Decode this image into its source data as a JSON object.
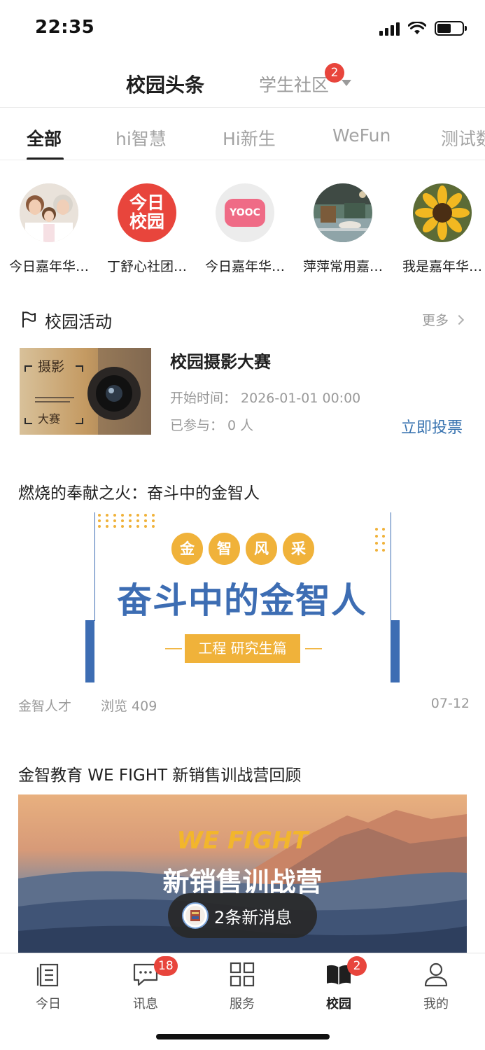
{
  "status_bar": {
    "time": "22:35"
  },
  "header": {
    "active_tab": "校园头条",
    "other_tab": "学生社区",
    "other_tab_badge": "2"
  },
  "category_tabs": [
    "全部",
    "hi智慧",
    "Hi新生",
    "WeFun",
    "测试数"
  ],
  "avatars": [
    {
      "label": "今日嘉年华…",
      "icon": "family-photo"
    },
    {
      "label": "丁舒心社团…",
      "icon": "jinri-xiaoyuan-logo",
      "logo_text_1": "今日",
      "logo_text_2": "校园"
    },
    {
      "label": "今日嘉年华…",
      "icon": "yooc-logo",
      "logo_text": "YOOC"
    },
    {
      "label": "萍萍常用嘉…",
      "icon": "interior-photo"
    },
    {
      "label": "我是嘉年华…",
      "icon": "sunflower-photo"
    }
  ],
  "activity_section": {
    "title": "校园活动",
    "more": "更多",
    "card": {
      "title": "校园摄影大赛",
      "start_time": "开始时间：  2026-01-01 00:00",
      "participants": "已参与：  0 人",
      "action": "立即投票",
      "thumb_text_1": "摄影",
      "thumb_text_2": "大赛"
    }
  },
  "article1": {
    "title": "燃烧的奉献之火：奋斗中的金智人",
    "banner": {
      "circles": [
        "金",
        "智",
        "风",
        "采"
      ],
      "headline": "奋斗中的金智人",
      "subline": "工程 研究生篇"
    },
    "author": "金智人才",
    "views": "浏览 409",
    "date": "07-12"
  },
  "article2": {
    "title": "金智教育 WE FIGHT 新销售训战营回顾",
    "banner": {
      "line1": "WE FIGHT",
      "line2": "新销售训战营"
    }
  },
  "toast": {
    "text": "2条新消息"
  },
  "bottom_nav": [
    {
      "label": "今日",
      "icon": "today-icon"
    },
    {
      "label": "讯息",
      "icon": "message-icon",
      "badge": "18"
    },
    {
      "label": "服务",
      "icon": "grid-icon"
    },
    {
      "label": "校园",
      "icon": "book-icon",
      "badge": "2",
      "active": true
    },
    {
      "label": "我的",
      "icon": "person-icon"
    }
  ],
  "colors": {
    "accent_blue": "#3873b0",
    "badge_red": "#e8453c",
    "banner_gold": "#f0b23a",
    "banner_blue": "#3d6db3"
  }
}
